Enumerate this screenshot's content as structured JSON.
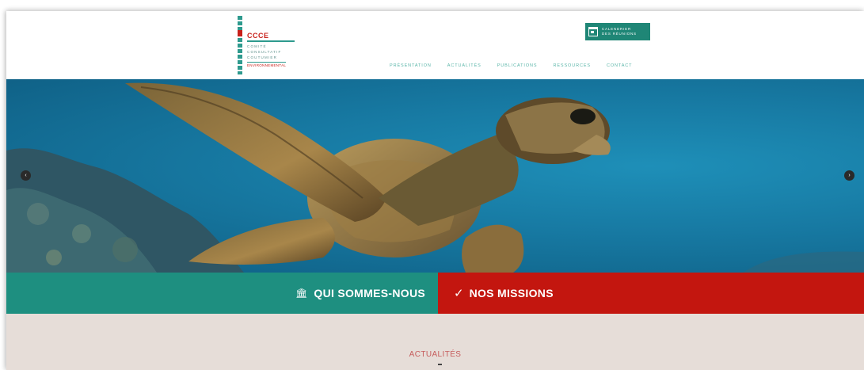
{
  "logo": {
    "title": "CCCE",
    "lines": [
      "COMITÉ",
      "CONSULTATIF",
      "COUTUMIER",
      "ENVIRONNEMENTAL"
    ]
  },
  "header": {
    "calendar_button": {
      "line1": "CALENDRIER",
      "line2": "DES RÉUNIONS"
    }
  },
  "nav": {
    "items": [
      "PRÉSENTATION",
      "ACTUALITÉS",
      "PUBLICATIONS",
      "RESSOURCES",
      "CONTACT"
    ]
  },
  "hero": {
    "prev_label": "‹",
    "next_label": "›"
  },
  "bands": {
    "left": {
      "icon": "building-icon",
      "label": "QUI SOMMES-NOUS"
    },
    "right": {
      "icon": "check-icon",
      "label": "NOS MISSIONS"
    }
  },
  "news": {
    "title": "ACTUALITÉS"
  },
  "colors": {
    "teal": "#1e8f80",
    "red": "#c3160f",
    "news_bg": "#e6ddd8",
    "news_title": "#c65c5c"
  }
}
